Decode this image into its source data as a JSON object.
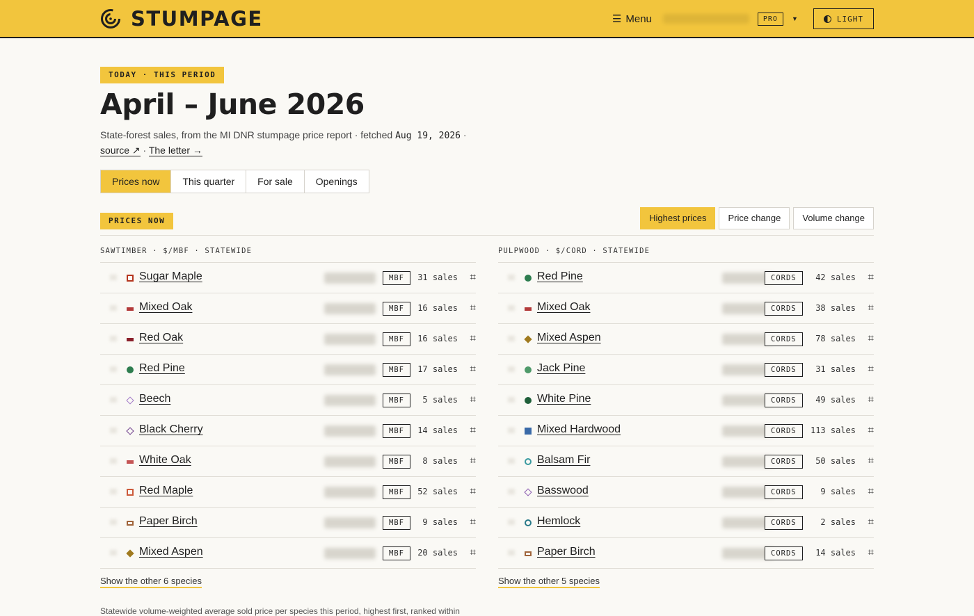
{
  "brand": {
    "name": "STUMPAGE"
  },
  "nav": {
    "menu_label": "Menu",
    "pro_label": "PRO",
    "theme_label": "LIGHT"
  },
  "header": {
    "tag": "TODAY · THIS PERIOD",
    "title": "April – June 2026",
    "subtitle_text": "State-forest sales, from the MI DNR stumpage price report · fetched",
    "fetched_date": "Aug 19, 2026",
    "source_link": "source ↗",
    "letter_link": "The letter →"
  },
  "tabs": [
    {
      "label": "Prices now",
      "active": true
    },
    {
      "label": "This quarter",
      "active": false
    },
    {
      "label": "For sale",
      "active": false
    },
    {
      "label": "Openings",
      "active": false
    }
  ],
  "section": {
    "tag": "PRICES NOW",
    "sort": [
      {
        "label": "Highest prices",
        "active": true
      },
      {
        "label": "Price change",
        "active": false
      },
      {
        "label": "Volume change",
        "active": false
      }
    ]
  },
  "sawtimber": {
    "heading": "SAWTIMBER · $/MBF · STATEWIDE",
    "unit": "MBF",
    "rows": [
      {
        "species": "Sugar Maple",
        "sales": "31 sales",
        "marker": "sq-outline",
        "color": "#b5361f"
      },
      {
        "species": "Mixed Oak",
        "sales": "16 sales",
        "marker": "bar",
        "color": "#b33a3a"
      },
      {
        "species": "Red Oak",
        "sales": "16 sales",
        "marker": "bar",
        "color": "#8a1f2a"
      },
      {
        "species": "Red Pine",
        "sales": "17 sales",
        "marker": "dot",
        "color": "#2e7d4f"
      },
      {
        "species": "Beech",
        "sales": "5 sales",
        "marker": "diamond-o",
        "color": "#a37bc8"
      },
      {
        "species": "Black Cherry",
        "sales": "14 sales",
        "marker": "diamond-o",
        "color": "#6b3a8a"
      },
      {
        "species": "White Oak",
        "sales": "8 sales",
        "marker": "bar",
        "color": "#c45454"
      },
      {
        "species": "Red Maple",
        "sales": "52 sales",
        "marker": "sq-outline",
        "color": "#cc5a3a"
      },
      {
        "species": "Paper Birch",
        "sales": "9 sales",
        "marker": "rect",
        "color": "#a0643a"
      },
      {
        "species": "Mixed Aspen",
        "sales": "20 sales",
        "marker": "diamond",
        "color": "#a07a1f"
      }
    ],
    "show_more": "Show the other 6 species"
  },
  "pulpwood": {
    "heading": "PULPWOOD · $/CORD · STATEWIDE",
    "unit": "CORDS",
    "rows": [
      {
        "species": "Red Pine",
        "sales": "42 sales",
        "marker": "dot",
        "color": "#2e7d4f"
      },
      {
        "species": "Mixed Oak",
        "sales": "38 sales",
        "marker": "bar",
        "color": "#b33a3a"
      },
      {
        "species": "Mixed Aspen",
        "sales": "78 sales",
        "marker": "diamond",
        "color": "#a07a1f"
      },
      {
        "species": "Jack Pine",
        "sales": "31 sales",
        "marker": "dot",
        "color": "#4f9a6a"
      },
      {
        "species": "White Pine",
        "sales": "49 sales",
        "marker": "dot",
        "color": "#1f5f3a"
      },
      {
        "species": "Mixed Hardwood",
        "sales": "113 sales",
        "marker": "sq",
        "color": "#3a6aa8"
      },
      {
        "species": "Balsam Fir",
        "sales": "50 sales",
        "marker": "ring",
        "color": "#3a9aa0"
      },
      {
        "species": "Basswood",
        "sales": "9 sales",
        "marker": "diamond-o",
        "color": "#8a5ab0"
      },
      {
        "species": "Hemlock",
        "sales": "2 sales",
        "marker": "ring",
        "color": "#2a7a8a"
      },
      {
        "species": "Paper Birch",
        "sales": "14 sales",
        "marker": "rect",
        "color": "#a0643a"
      }
    ],
    "show_more": "Show the other 5 species"
  },
  "footnote": "Statewide volume-weighted average sold price per species this period, highest first, ranked within"
}
